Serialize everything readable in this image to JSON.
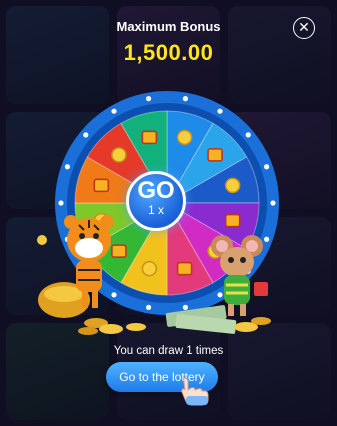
{
  "modal": {
    "title": "Maximum Bonus",
    "amount": "1,500.00",
    "close_icon": "close-icon",
    "go_label": "GO",
    "go_count": "1 x",
    "draw_text": "You can draw 1 times",
    "lottery_button_label": "Go to the lottery"
  },
  "wheel": {
    "segments": [
      {
        "color": "#1f8be8",
        "prize_icon": "coin-icon"
      },
      {
        "color": "#2aa4ea",
        "prize_icon": "gift-icon"
      },
      {
        "color": "#1d5ac9",
        "prize_icon": "coin-icon"
      },
      {
        "color": "#8a2bd0",
        "prize_icon": "gift-icon"
      },
      {
        "color": "#d12bc4",
        "prize_icon": "coin-icon"
      },
      {
        "color": "#e23a7a",
        "prize_icon": "gift-icon"
      },
      {
        "color": "#f2c21c",
        "prize_icon": "coin-icon"
      },
      {
        "color": "#34b834",
        "prize_icon": "gift-icon"
      },
      {
        "color": "#7fc82a",
        "prize_icon": "coin-icon"
      },
      {
        "color": "#f07a18",
        "prize_icon": "gift-icon"
      },
      {
        "color": "#e53a2a",
        "prize_icon": "coin-icon"
      },
      {
        "color": "#12b07a",
        "prize_icon": "gift-icon"
      }
    ],
    "rim_color": "#1a6fd9",
    "bulb_color": "#ffffff"
  },
  "colors": {
    "accent_yellow": "#ffe61a",
    "button_blue": "#1e7bea"
  }
}
